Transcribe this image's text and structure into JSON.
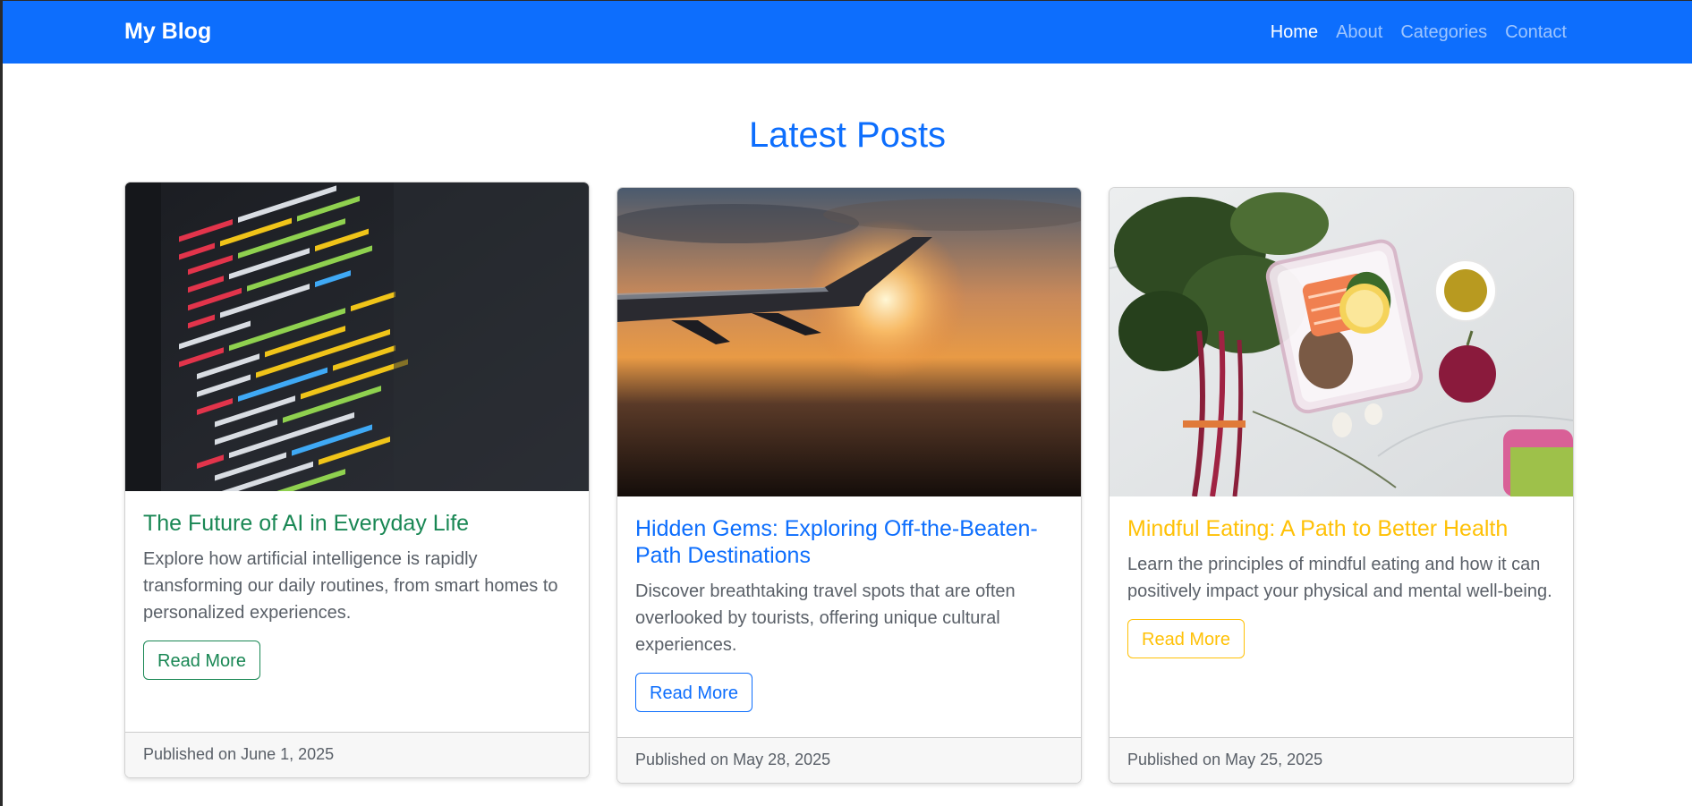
{
  "nav": {
    "brand": "My Blog",
    "links": [
      {
        "label": "Home",
        "active": true
      },
      {
        "label": "About",
        "active": false
      },
      {
        "label": "Categories",
        "active": false
      },
      {
        "label": "Contact",
        "active": false
      }
    ]
  },
  "main": {
    "heading": "Latest Posts",
    "posts": [
      {
        "title": "The Future of AI in Everyday Life",
        "excerpt": "Explore how artificial intelligence is rapidly transforming our daily routines, from smart homes to personalized experiences.",
        "button_label": "Read More",
        "footer": "Published on June 1, 2025",
        "accent_color": "#198754",
        "image": "code-editor-photo"
      },
      {
        "title": "Hidden Gems: Exploring Off-the-Beaten-Path Destinations",
        "excerpt": "Discover breathtaking travel spots that are often overlooked by tourists, offering unique cultural experiences.",
        "button_label": "Read More",
        "footer": "Published on May 28, 2025",
        "accent_color": "#0d6efd",
        "image": "airplane-wing-sunset-photo"
      },
      {
        "title": "Mindful Eating: A Path to Better Health",
        "excerpt": "Learn the principles of mindful eating and how it can positively impact your physical and mental well-being.",
        "button_label": "Read More",
        "footer": "Published on May 25, 2025",
        "accent_color": "#ffc107",
        "image": "healthy-food-flatlay-photo"
      }
    ]
  }
}
